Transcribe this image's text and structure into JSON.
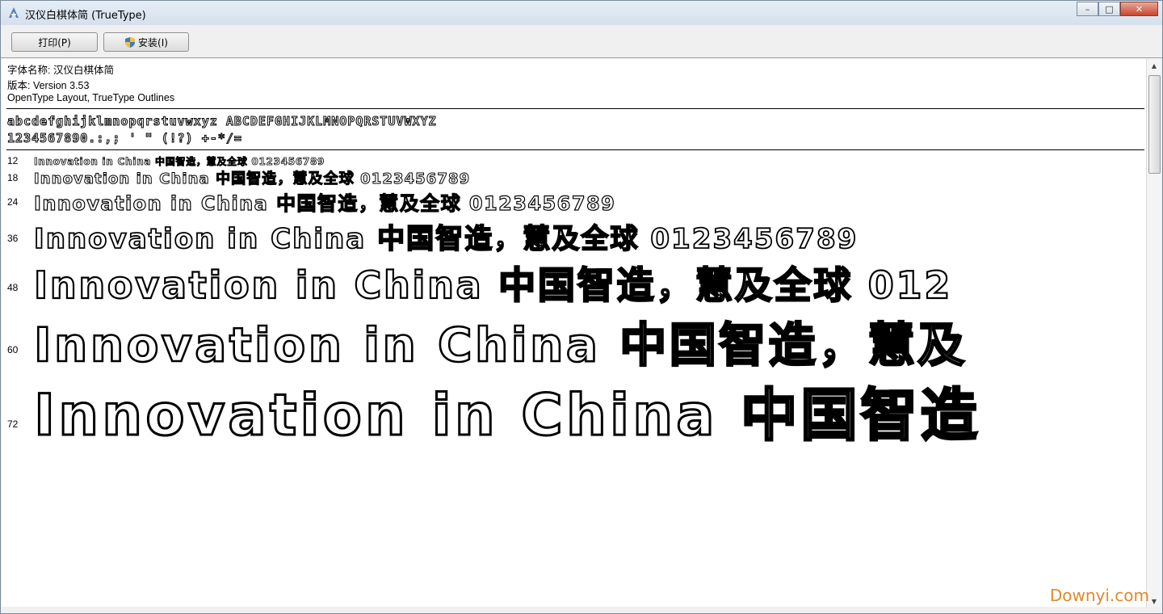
{
  "window": {
    "title": "汉仪白棋体简 (TrueType)",
    "controls": {
      "minimize": "–",
      "maximize": "□",
      "close": "✕"
    }
  },
  "toolbar": {
    "print_label": "打印(P)",
    "install_label": "安装(I)"
  },
  "font_info": {
    "name_line": "字体名称: 汉仪白棋体简",
    "version_line": "版本: Version 3.53",
    "type_line": "OpenType Layout, TrueType Outlines"
  },
  "charset": {
    "line1": "abcdefghijklmnopqrstuvwxyz ABCDEFGHIJKLMNOPQRSTUVWXYZ",
    "line2": "1234567890.:,; ' \" (!?) +-*/="
  },
  "samples": [
    {
      "size_label": "12",
      "text": "Innovation in China 中国智造，慧及全球 0123456789"
    },
    {
      "size_label": "18",
      "text": "Innovation in China 中国智造，慧及全球 0123456789"
    },
    {
      "size_label": "24",
      "text": "Innovation in China 中国智造，慧及全球 0123456789"
    },
    {
      "size_label": "36",
      "text": "Innovation in China 中国智造，慧及全球 0123456789"
    },
    {
      "size_label": "48",
      "text": "Innovation in China 中国智造，慧及全球 012"
    },
    {
      "size_label": "60",
      "text": "Innovation in China 中国智造，慧及"
    },
    {
      "size_label": "72",
      "text": "Innovation in China 中国智造"
    }
  ],
  "watermark": "Downyi.com",
  "icons": {
    "app": "font-viewer-icon",
    "shield": "uac-shield-icon"
  }
}
